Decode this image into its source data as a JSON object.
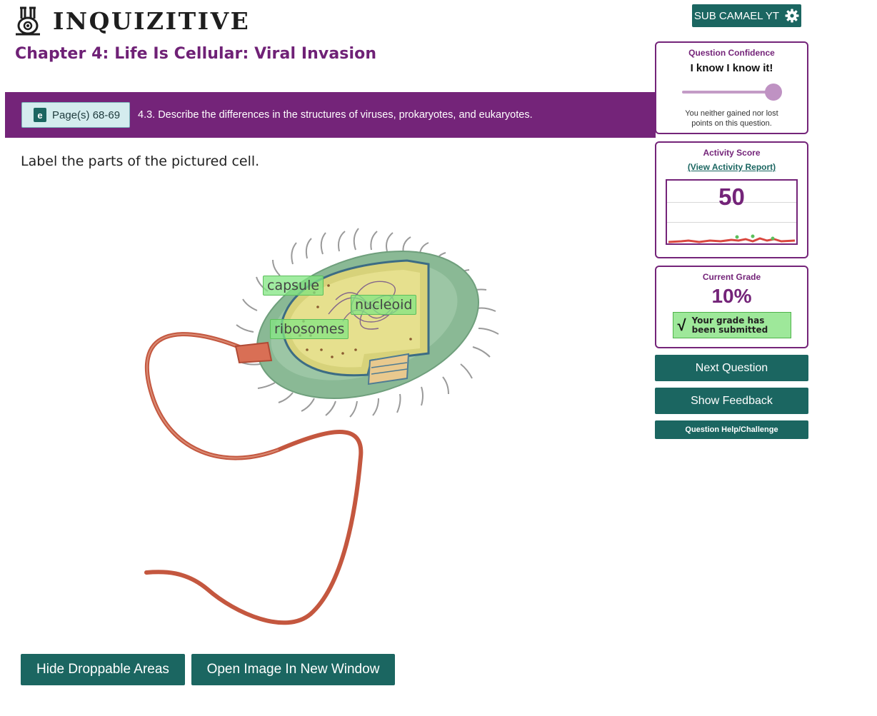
{
  "header": {
    "logo_text": "INQUIZITIVE",
    "user_label": "SUB CAMAEL YT"
  },
  "chapter_title": "Chapter 4: Life Is Cellular: Viral Invasion",
  "objective": {
    "pages_label": "Page(s) 68-69",
    "ebook_glyph": "e",
    "text": "4.3. Describe the differences in the structures of viruses, prokaryotes, and eukaryotes."
  },
  "question": {
    "prompt": "Label the parts of the pictured cell.",
    "labels": [
      "capsule",
      "nucleoid",
      "ribosomes"
    ]
  },
  "buttons": {
    "hide_droppable": "Hide Droppable Areas",
    "open_image": "Open Image In New Window",
    "next_question": "Next Question",
    "show_feedback": "Show Feedback",
    "help": "Question Help/Challenge"
  },
  "confidence": {
    "title": "Question Confidence",
    "level_text": "I know I know it!",
    "level_fraction": 1.0,
    "note": "You neither gained nor lost points on this question."
  },
  "activity": {
    "title": "Activity Score",
    "link": "(View Activity Report)",
    "score": "50"
  },
  "grade": {
    "title": "Current Grade",
    "value": "10%",
    "check": "√",
    "status": "Your grade has been submitted"
  },
  "colors": {
    "brand_purple": "#742479",
    "teal": "#1b6661",
    "label_green": "#82e682"
  }
}
